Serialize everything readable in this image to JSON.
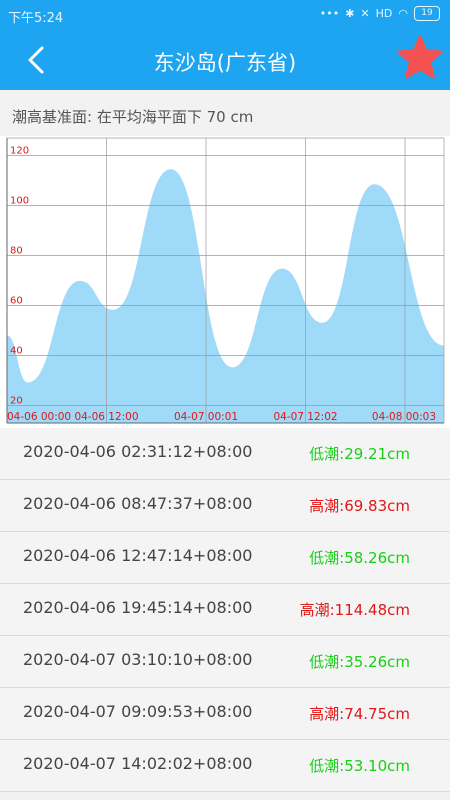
{
  "status_bar": {
    "time": "下午5:24",
    "signal": "HD",
    "battery": "19"
  },
  "app_bar": {
    "title": "东沙岛(广东省)"
  },
  "datum_note": "潮高基准面: 在平均海平面下 70 cm",
  "colors": {
    "primary": "#1ea5f2",
    "fill": "#9fdaf8",
    "low": "#17d017",
    "high": "#e01818",
    "star": "#f25252"
  },
  "chart_data": {
    "type": "area",
    "y_ticks": [
      "120",
      "100",
      "80",
      "60",
      "40",
      "20"
    ],
    "ylim": [
      13,
      127
    ],
    "x_tick_labels": [
      "04-06 00:00",
      "04-06 12:00",
      "04-07 00:01",
      "04-07 12:02",
      "04-08 00:03"
    ],
    "x_ticks_hours": [
      0,
      12,
      24,
      36,
      48
    ],
    "xlim_hours": [
      0,
      52.7
    ],
    "grid": true,
    "series": [
      {
        "hours": [
          0,
          2.52,
          8.79,
          12.79,
          19.76,
          27.17,
          33.17,
          38.03,
          44.3,
          52.7
        ],
        "values": [
          48,
          29.21,
          69.83,
          58.26,
          114.48,
          35.26,
          74.75,
          53.1,
          108.5,
          44
        ]
      }
    ]
  },
  "tides": [
    {
      "time": "2020-04-06 02:31:12+08:00",
      "label": "低潮:29.21cm",
      "kind": "low"
    },
    {
      "time": "2020-04-06 08:47:37+08:00",
      "label": "高潮:69.83cm",
      "kind": "high"
    },
    {
      "time": "2020-04-06 12:47:14+08:00",
      "label": "低潮:58.26cm",
      "kind": "low"
    },
    {
      "time": "2020-04-06 19:45:14+08:00",
      "label": "高潮:114.48cm",
      "kind": "high"
    },
    {
      "time": "2020-04-07 03:10:10+08:00",
      "label": "低潮:35.26cm",
      "kind": "low"
    },
    {
      "time": "2020-04-07 09:09:53+08:00",
      "label": "高潮:74.75cm",
      "kind": "high"
    },
    {
      "time": "2020-04-07 14:02:02+08:00",
      "label": "低潮:53.10cm",
      "kind": "low"
    }
  ]
}
